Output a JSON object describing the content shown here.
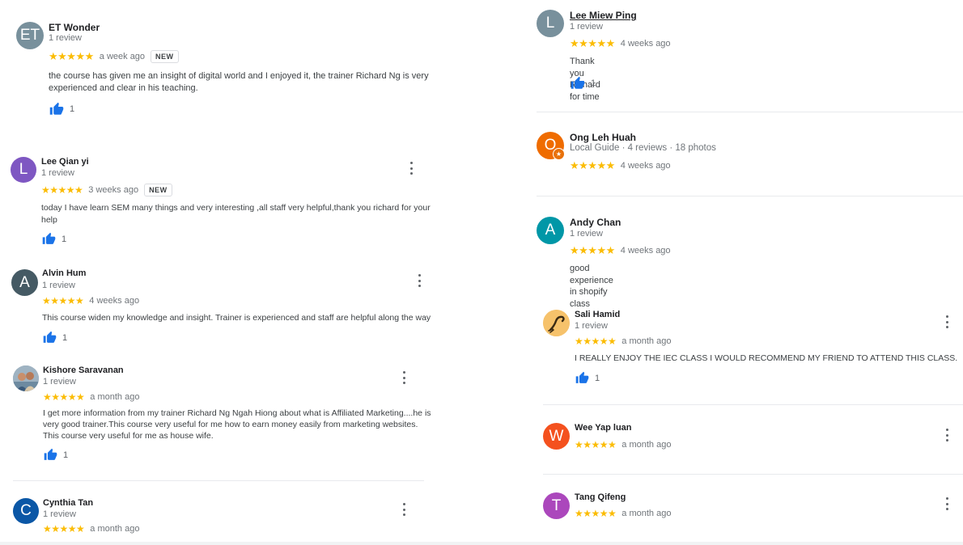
{
  "reviews": [
    {
      "name": "ET Wonder",
      "initials": "ET",
      "avatar_color": "#78909c",
      "meta": "1 review",
      "stars": "★★★★★",
      "time": "a week ago",
      "badge": "NEW",
      "text": "the course has given me an insight of digital world and I enjoyed it, the trainer Richard Ng is very experienced and clear in his teaching.",
      "likes": "1"
    },
    {
      "name": "Lee Qian yi",
      "initials": "L",
      "avatar_color": "#7e57c2",
      "meta": "1 review",
      "stars": "★★★★★",
      "time": "3 weeks ago",
      "badge": "NEW",
      "text": "today I have learn SEM many things and very interesting ,all staff very helpful,thank you richard for your help",
      "likes": "1"
    },
    {
      "name": "Alvin Hum",
      "initials": "A",
      "avatar_color": "#455a64",
      "meta": "1 review",
      "stars": "★★★★★",
      "time": "4 weeks ago",
      "text": "This course widen my knowledge and insight. Trainer is experienced and staff are helpful along the way",
      "likes": "1"
    },
    {
      "name": "Kishore Saravanan",
      "avatar_color": "#8d9aa5",
      "meta": "1 review",
      "stars": "★★★★★",
      "time": "a month ago",
      "text": "I get more information from my trainer Richard Ng Ngah Hiong about what is Affiliated Marketing....he is very good trainer.This course very useful for me how to earn money easily from marketing websites. This course very useful for me as house wife.",
      "likes": "1"
    },
    {
      "name": "Cynthia Tan",
      "initials": "C",
      "avatar_color": "#0b57a6",
      "meta": "1 review",
      "stars": "★★★★★",
      "time": "a month ago"
    },
    {
      "name": "Lee Miew Ping",
      "initials": "L",
      "avatar_color": "#78909c",
      "meta": "1 review",
      "stars": "★★★★★",
      "time": "4 weeks ago",
      "text": "Thank you Richard for time",
      "likes": "1"
    },
    {
      "name": "Ong Leh Huah",
      "initials": "O",
      "avatar_color": "#ef6c00",
      "meta": "Local Guide · 4 reviews · 18 photos",
      "stars": "★★★★★",
      "time": "4 weeks ago"
    },
    {
      "name": "Andy Chan",
      "initials": "A",
      "avatar_color": "#0097a7",
      "meta": "1 review",
      "stars": "★★★★★",
      "time": "4 weeks ago",
      "text": "good experience in shopify class"
    },
    {
      "name": "Sali Hamid",
      "avatar_color": "#f6c26b",
      "meta": "1 review",
      "stars": "★★★★★",
      "time": "a month ago",
      "text": "I REALLY ENJOY THE IEC CLASS I WOULD RECOMMEND MY FRIEND TO ATTEND THIS CLASS.",
      "likes": "1"
    },
    {
      "name": "Wee Yap luan",
      "initials": "W",
      "avatar_color": "#f4511e",
      "stars": "★★★★★",
      "time": "a month ago"
    },
    {
      "name": "Tang Qifeng",
      "initials": "T",
      "avatar_color": "#ab47bc",
      "stars": "★★★★★",
      "time": "a month ago"
    }
  ]
}
